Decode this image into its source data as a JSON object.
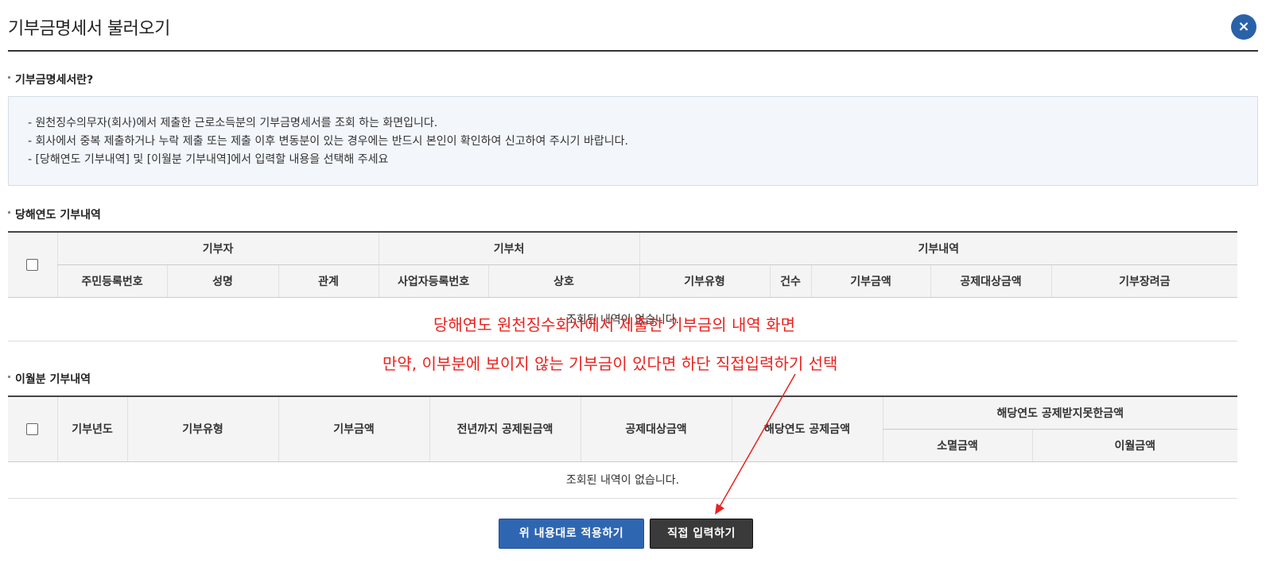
{
  "dialog": {
    "title": "기부금명세서 불러오기",
    "close_symbol": "×"
  },
  "info_section": {
    "heading": "기부금명세서란?",
    "lines": [
      "- 원천징수의무자(회사)에서 제출한 근로소득분의 기부금명세서를 조회 하는 화면입니다.",
      "- 회사에서 중복 제출하거나 누락 제출 또는 제출 이후 변동분이 있는 경우에는 반드시 본인이 확인하여 신고하여 주시기 바랍니다.",
      "- [당해연도 기부내역] 및 [이월분 기부내역]에서 입력할 내용을 선택해 주세요"
    ]
  },
  "current_year": {
    "heading": "당해연도 기부내역",
    "group_headers": [
      "기부자",
      "기부처",
      "기부내역"
    ],
    "columns": [
      "주민등록번호",
      "성명",
      "관계",
      "사업자등록번호",
      "상호",
      "기부유형",
      "건수",
      "기부금액",
      "공제대상금액",
      "기부장려금"
    ],
    "empty_message": "조회된 내역이 없습니다."
  },
  "carryover": {
    "heading": "이월분 기부내역",
    "columns": [
      "기부년도",
      "기부유형",
      "기부금액",
      "전년까지 공제된금액",
      "공제대상금액",
      "해당연도 공제금액"
    ],
    "group_header": "해당연도 공제받지못한금액",
    "sub_columns": [
      "소멸금액",
      "이월금액"
    ],
    "empty_message": "조회된 내역이 없습니다."
  },
  "annotations": {
    "line1": "당해연도 원천징수회사에서 제출한 기부금의 내역 화면",
    "line2": "만약, 이부분에 보이지 않는 기부금이 있다면 하단 직접입력하기 선택"
  },
  "buttons": {
    "apply_label": "위 내용대로 적용하기",
    "manual_label": "직접 입력하기"
  },
  "colors": {
    "annotation": "#e8231f",
    "apply_button": "#2f66b2",
    "manual_button": "#3a3a3a",
    "close_button": "#2a62a8"
  }
}
